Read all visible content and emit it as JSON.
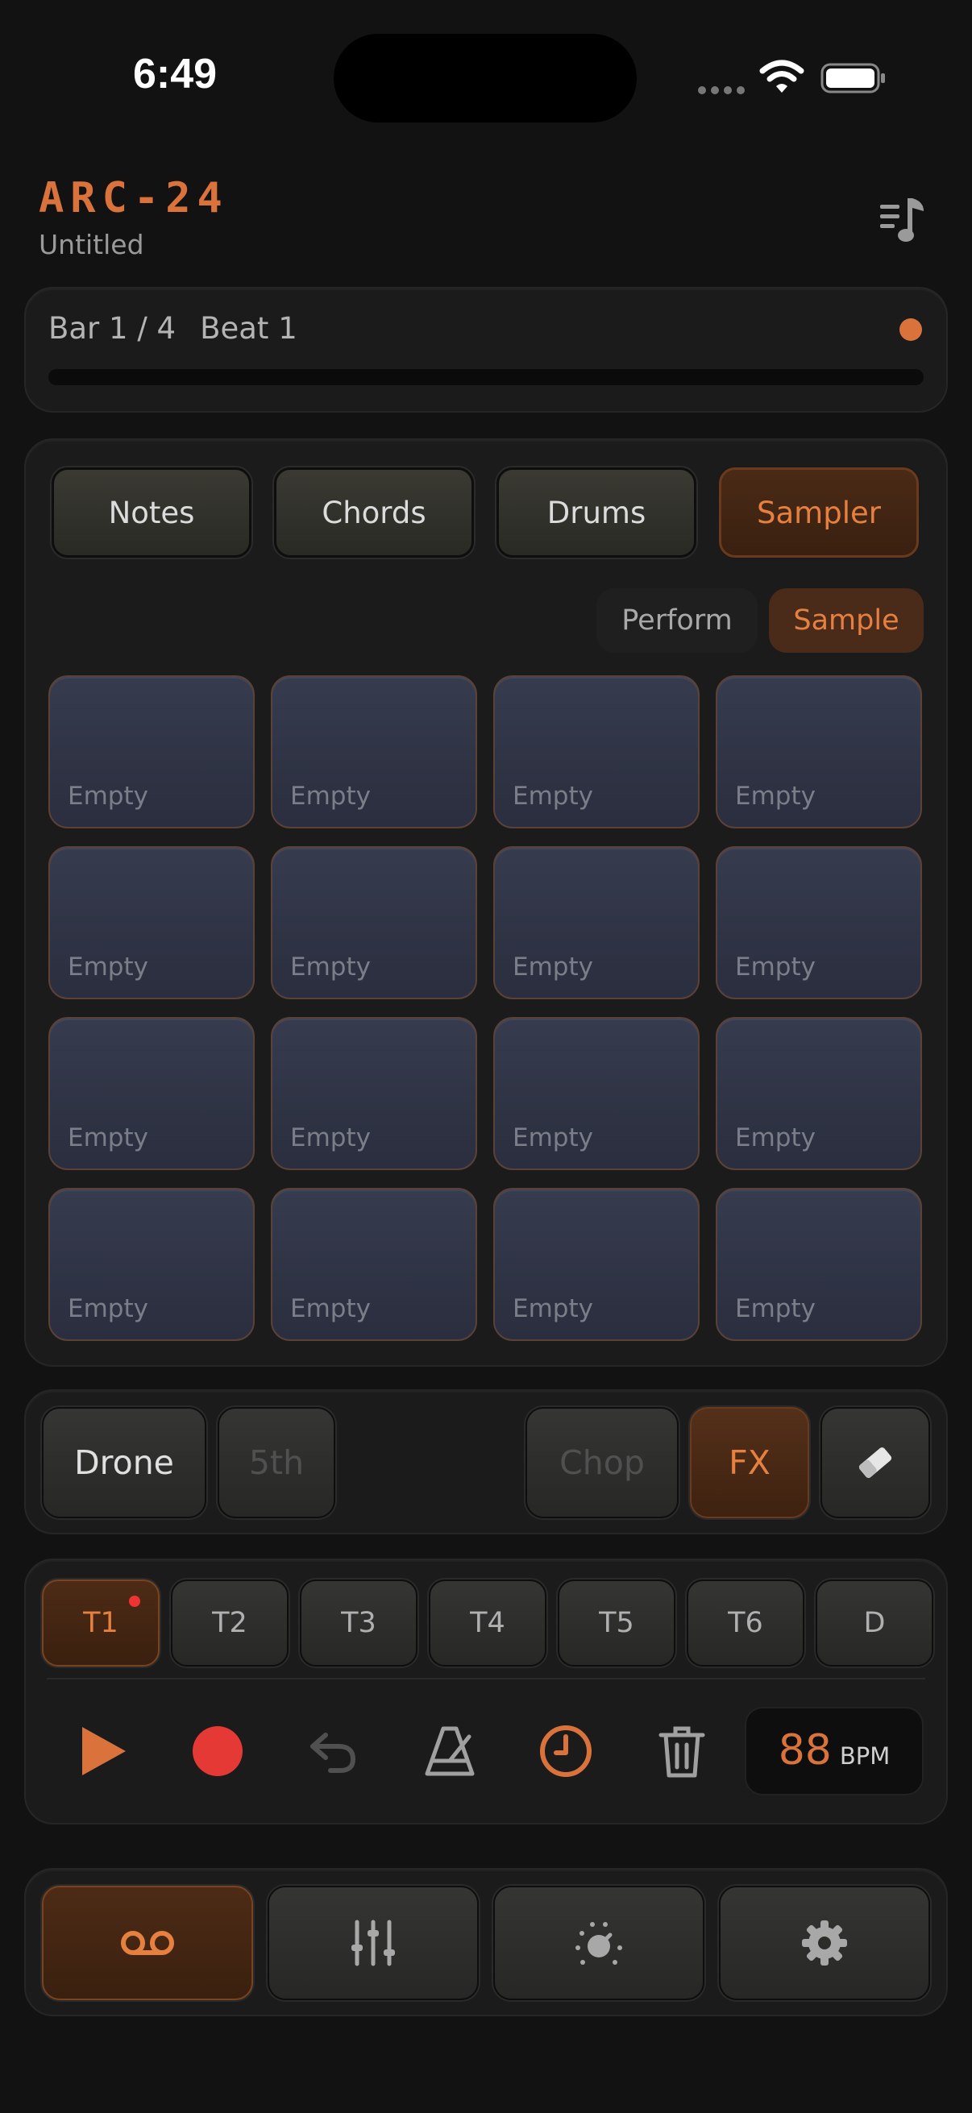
{
  "status_bar": {
    "time": "6:49"
  },
  "header": {
    "title": "ARC-24",
    "subtitle": "Untitled"
  },
  "position": {
    "bar": "Bar 1 / 4",
    "beat": "Beat 1",
    "progress": 0.0
  },
  "modes": [
    {
      "label": "Notes",
      "active": false
    },
    {
      "label": "Chords",
      "active": false
    },
    {
      "label": "Drums",
      "active": false
    },
    {
      "label": "Sampler",
      "active": true
    }
  ],
  "sampler_view": {
    "perform_label": "Perform",
    "sample_label": "Sample",
    "selected": "Sample"
  },
  "pads": [
    "Empty",
    "Empty",
    "Empty",
    "Empty",
    "Empty",
    "Empty",
    "Empty",
    "Empty",
    "Empty",
    "Empty",
    "Empty",
    "Empty",
    "Empty",
    "Empty",
    "Empty",
    "Empty"
  ],
  "tools": {
    "drone": "Drone",
    "fifth": "5th",
    "chop": "Chop",
    "fx": "FX",
    "eraser_icon": "eraser-icon"
  },
  "tracks": [
    {
      "label": "T1",
      "active": true,
      "has_content": true
    },
    {
      "label": "T2",
      "active": false
    },
    {
      "label": "T3",
      "active": false
    },
    {
      "label": "T4",
      "active": false
    },
    {
      "label": "T5",
      "active": false
    },
    {
      "label": "T6",
      "active": false
    },
    {
      "label": "D",
      "active": false
    }
  ],
  "transport": {
    "bpm": "88",
    "bpm_unit": "BPM"
  },
  "bottom_nav": [
    {
      "icon": "voicemail-icon",
      "active": true
    },
    {
      "icon": "mixer-sliders-icon",
      "active": false
    },
    {
      "icon": "dial-knob-icon",
      "active": false
    },
    {
      "icon": "gear-icon",
      "active": false
    }
  ],
  "colors": {
    "accent": "#d9733b",
    "record": "#e53935",
    "pad": "#30344a",
    "background": "#121212"
  }
}
